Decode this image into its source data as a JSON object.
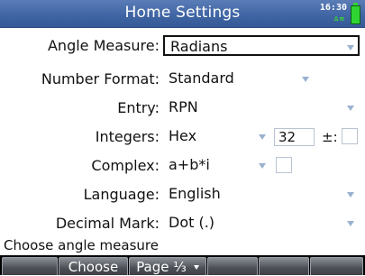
{
  "header": {
    "title": "Home Settings",
    "time": "16:30",
    "signal_text": "∆π",
    "battery": "battery-full-icon"
  },
  "settings": {
    "angle": {
      "label": "Angle Measure:",
      "value": "Radians"
    },
    "number_format": {
      "label": "Number Format:",
      "value": "Standard"
    },
    "entry": {
      "label": "Entry:",
      "value": "RPN"
    },
    "integers": {
      "label": "Integers:",
      "value": "Hex",
      "bits": "32",
      "signed_label": "±:"
    },
    "complex": {
      "label": "Complex:",
      "value": "a+b*i"
    },
    "language": {
      "label": "Language:",
      "value": "English"
    },
    "decimal": {
      "label": "Decimal Mark:",
      "value": "Dot (.)"
    }
  },
  "help_text": "Choose angle measure",
  "menu": {
    "choose": "Choose",
    "page": "Page ⅓"
  },
  "colors": {
    "title_bar": "#3f64a3",
    "dropdown_arrow": "#9bb1cf",
    "battery": "#2fd433"
  }
}
